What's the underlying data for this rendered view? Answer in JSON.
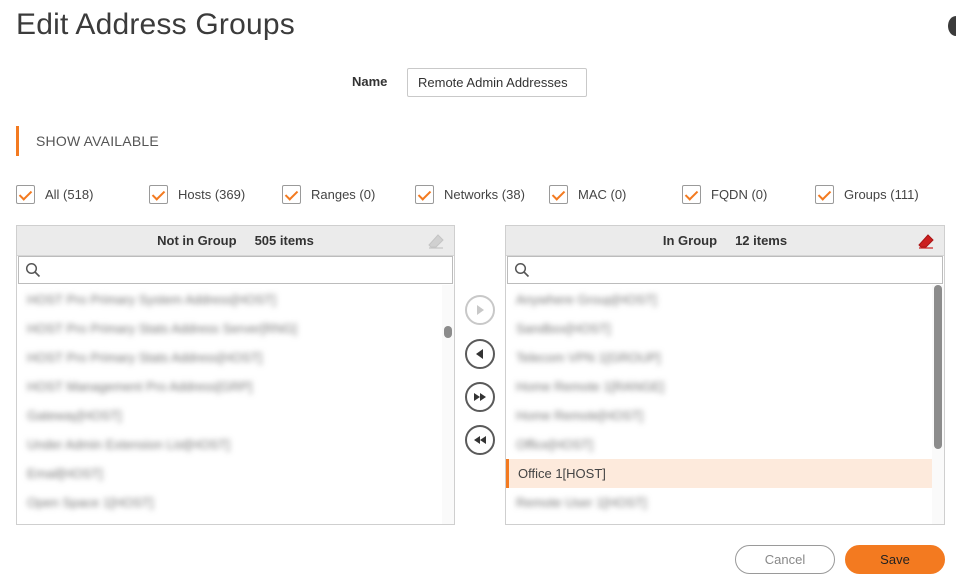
{
  "dialog": {
    "title": "Edit Address Groups"
  },
  "name_field": {
    "label": "Name",
    "value": "Remote Admin Addresses"
  },
  "section": {
    "label": "SHOW AVAILABLE"
  },
  "filters": [
    {
      "label": "All (518)",
      "checked": true
    },
    {
      "label": "Hosts (369)",
      "checked": true
    },
    {
      "label": "Ranges (0)",
      "checked": true
    },
    {
      "label": "Networks (38)",
      "checked": true
    },
    {
      "label": "MAC (0)",
      "checked": true
    },
    {
      "label": "FQDN (0)",
      "checked": true
    },
    {
      "label": "Groups (111)",
      "checked": true
    }
  ],
  "left_panel": {
    "title": "Not in Group",
    "count": "505 items",
    "items": [
      "HOST Pro Primary System Address[HOST]",
      "HOST Pro Primary Stats Address Server[RNG]",
      "HOST Pro Primary Stats Address[HOST]",
      "HOST Management Pro Address[GRP]",
      "Gateway[HOST]",
      "Under Admin Extension List[HOST]",
      "Email[HOST]",
      "Open Space 1[HOST]"
    ],
    "scroll_position": 0.18
  },
  "right_panel": {
    "title": "In Group",
    "count": "12 items",
    "eraser_color": "#cc1f1f",
    "items": [
      {
        "label": "Anywhere Group[HOST]",
        "selected": false,
        "blurred": true
      },
      {
        "label": "Sandbox[HOST]",
        "selected": false,
        "blurred": true
      },
      {
        "label": "Telecom VPN 1[GROUP]",
        "selected": false,
        "blurred": true
      },
      {
        "label": "Home Remote 1[RANGE]",
        "selected": false,
        "blurred": true
      },
      {
        "label": "Home Remote[HOST]",
        "selected": false,
        "blurred": true
      },
      {
        "label": "Office[HOST]",
        "selected": false,
        "blurred": true
      },
      {
        "label": "Office 1[HOST]",
        "selected": true,
        "blurred": false
      },
      {
        "label": "Remote User 1[HOST]",
        "selected": false,
        "blurred": true
      }
    ],
    "scroll_position": 0.0
  },
  "move_buttons": [
    {
      "name": "move-right-button",
      "icon": "play-right-icon",
      "enabled": false
    },
    {
      "name": "move-left-button",
      "icon": "play-left-icon",
      "enabled": true
    },
    {
      "name": "move-all-right-button",
      "icon": "fast-forward-icon",
      "enabled": true
    },
    {
      "name": "move-all-left-button",
      "icon": "rewind-icon",
      "enabled": true
    }
  ],
  "actions": {
    "cancel_label": "Cancel",
    "save_label": "Save"
  },
  "colors": {
    "accent": "#f37a20",
    "selected_row": "#fdeadc"
  }
}
